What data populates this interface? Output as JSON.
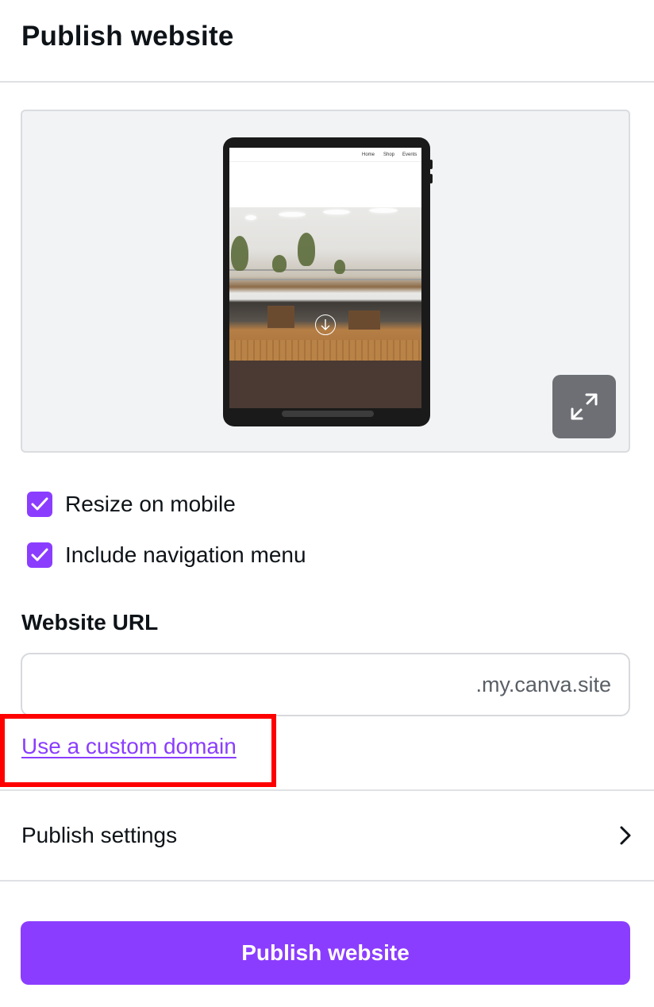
{
  "header": {
    "title": "Publish website"
  },
  "preview": {
    "site_nav": [
      "Home",
      "Shop",
      "Events"
    ],
    "expand_icon": "expand-arrows-icon",
    "scroll_icon": "arrow-down-circle-icon"
  },
  "options": [
    {
      "label": "Resize on mobile",
      "checked": true
    },
    {
      "label": "Include navigation menu",
      "checked": true
    }
  ],
  "url": {
    "label": "Website URL",
    "value": "",
    "suffix": ".my.canva.site"
  },
  "custom_domain_link": "Use a custom domain",
  "settings": {
    "label": "Publish settings",
    "icon": "chevron-right-icon"
  },
  "publish_button": "Publish website",
  "colors": {
    "accent": "#8b3dff",
    "highlight": "#ff0000",
    "expand_button": "#6d6f74"
  }
}
